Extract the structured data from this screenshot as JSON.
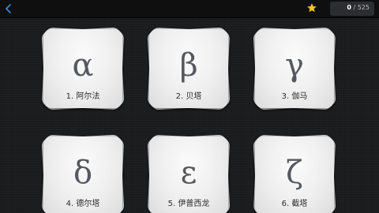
{
  "topbar": {
    "back_icon": "chevron-left-icon",
    "star_icon": "star-icon",
    "score_value": "0",
    "score_separator": " / ",
    "score_total": "525",
    "star_color": "#f5c518",
    "back_color": "#3b8fd8"
  },
  "cards": [
    {
      "glyph": "α",
      "label": "1. 阿尔法"
    },
    {
      "glyph": "β",
      "label": "2. 贝塔"
    },
    {
      "glyph": "γ",
      "label": "3. 伽马"
    },
    {
      "glyph": "δ",
      "label": "4. 德尔塔"
    },
    {
      "glyph": "ε",
      "label": "5. 伊普西龙"
    },
    {
      "glyph": "ζ",
      "label": "6. 截塔"
    }
  ]
}
